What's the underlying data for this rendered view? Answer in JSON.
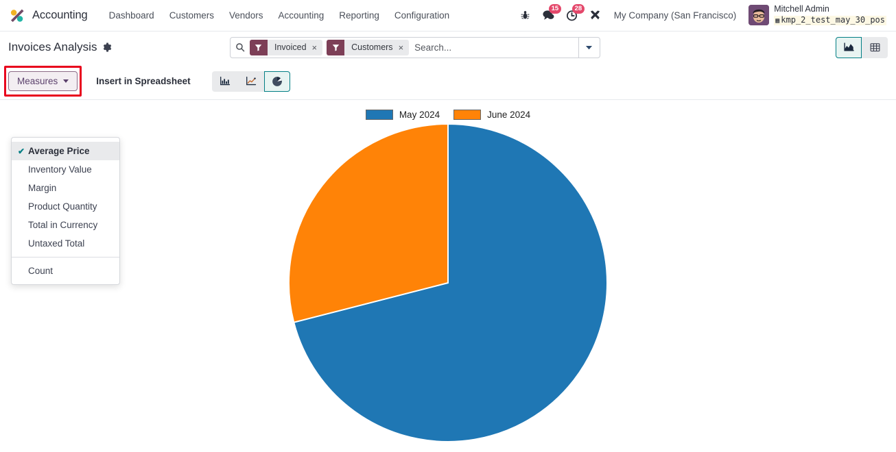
{
  "navbar": {
    "brand": "Accounting",
    "logo_icon": "odoo-logo",
    "menu": [
      {
        "label": "Dashboard"
      },
      {
        "label": "Customers"
      },
      {
        "label": "Vendors"
      },
      {
        "label": "Accounting"
      },
      {
        "label": "Reporting"
      },
      {
        "label": "Configuration"
      }
    ],
    "sys_icons": [
      {
        "name": "bug-icon",
        "glyph": "☣",
        "badge": null
      },
      {
        "name": "messages-icon",
        "glyph": "💬",
        "badge": "15"
      },
      {
        "name": "activities-clock-icon",
        "glyph": "🕒",
        "badge": "28"
      },
      {
        "name": "tools-icon",
        "glyph": "⚒",
        "badge": null
      }
    ],
    "company": "My Company (San Francisco)",
    "user": {
      "name": "Mitchell Admin",
      "database": "kmp_2_test_may_30_pos",
      "db_icon": "database-icon",
      "avatar": "avatar"
    }
  },
  "control_panel": {
    "breadcrumb": "Invoices Analysis",
    "gear_icon": "gear-icon",
    "search": {
      "placeholder": "Search...",
      "value": "",
      "search_icon": "search-icon",
      "toggle_icon": "chevron-down-icon",
      "facets": [
        {
          "icon": "filter-icon",
          "label": "Invoiced",
          "remove": "×"
        },
        {
          "icon": "filter-icon",
          "label": "Customers",
          "remove": "×"
        }
      ]
    },
    "view_switcher": [
      {
        "name": "view-graph",
        "icon": "area-chart-icon",
        "active": true
      },
      {
        "name": "view-pivot",
        "icon": "pivot-table-icon",
        "active": false
      }
    ],
    "measures_label": "Measures",
    "insert_spreadsheet_label": "Insert in Spreadsheet",
    "chart_types": [
      {
        "name": "bar-chart-button",
        "icon": "bar-chart-icon",
        "active": false
      },
      {
        "name": "line-chart-button",
        "icon": "line-chart-icon",
        "active": false
      },
      {
        "name": "pie-chart-button",
        "icon": "pie-chart-icon",
        "active": true
      }
    ],
    "highlight_color": "#e8001c"
  },
  "measures_dropdown": {
    "open": true,
    "items": [
      {
        "label": "Average Price",
        "selected": true
      },
      {
        "label": "Inventory Value",
        "selected": false
      },
      {
        "label": "Margin",
        "selected": false
      },
      {
        "label": "Product Quantity",
        "selected": false
      },
      {
        "label": "Total in Currency",
        "selected": false
      },
      {
        "label": "Untaxed Total",
        "selected": false
      }
    ],
    "footer_items": [
      {
        "label": "Count",
        "selected": false
      }
    ],
    "check_glyph": "✔"
  },
  "chart_data": {
    "type": "pie",
    "title": "",
    "measure": "Average Price",
    "categories": [
      "May 2024",
      "June 2024"
    ],
    "values": [
      71,
      29
    ],
    "colors": [
      "#1f77b4",
      "#ff8307"
    ],
    "legend_position": "top",
    "start_angle_deg": 0,
    "slices": [
      {
        "label": "May 2024",
        "value": 71,
        "color": "#1f77b4",
        "start_deg": 0,
        "end_deg": 255
      },
      {
        "label": "June 2024",
        "value": 29,
        "color": "#ff8307",
        "start_deg": 255,
        "end_deg": 360
      }
    ]
  }
}
